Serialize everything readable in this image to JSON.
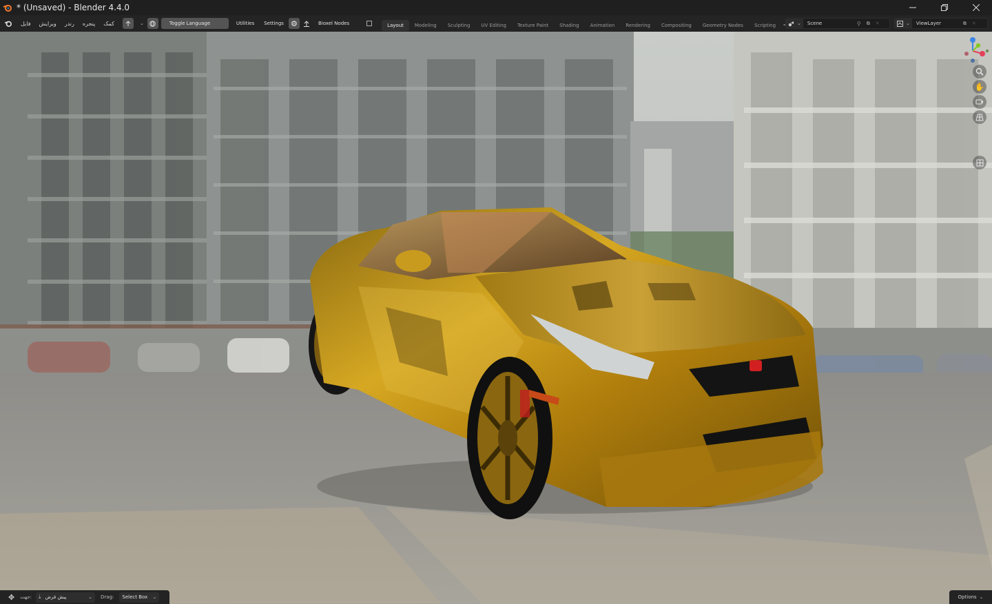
{
  "window": {
    "title": "* (Unsaved) - Blender 4.4.0"
  },
  "menu": {
    "items": [
      "فایل",
      "ویرایش",
      "رندر",
      "پنجره",
      "کمک"
    ]
  },
  "toolbar": {
    "toggle_language": "Toggle Language",
    "utilities": "Utilities",
    "settings": "Settings",
    "bioxel_nodes": "Bioxel Nodes"
  },
  "workspaces": {
    "active": "Layout",
    "tabs": [
      "Layout",
      "Modeling",
      "Sculpting",
      "UV Editing",
      "Texture Paint",
      "Shading",
      "Animation",
      "Rendering",
      "Compositing",
      "Geometry Nodes",
      "Scripting"
    ]
  },
  "scene": {
    "name": "Scene",
    "view_layer": "ViewLayer"
  },
  "footer": {
    "orientation_label": "جهت:",
    "orientation_value": "پیش فرض",
    "drag_label": "Drag:",
    "drag_value": "Select Box",
    "options": "Options"
  },
  "colors": {
    "accent_gizmo_x": "#e3405a",
    "accent_gizmo_y": "#85c826",
    "accent_gizmo_z": "#3b86e8",
    "car_body": "#b8860b"
  },
  "icons": {
    "nav": [
      "zoom-icon",
      "pan-hand-icon",
      "camera-view-icon",
      "perspective-grid-icon",
      "local-view-icon"
    ]
  }
}
